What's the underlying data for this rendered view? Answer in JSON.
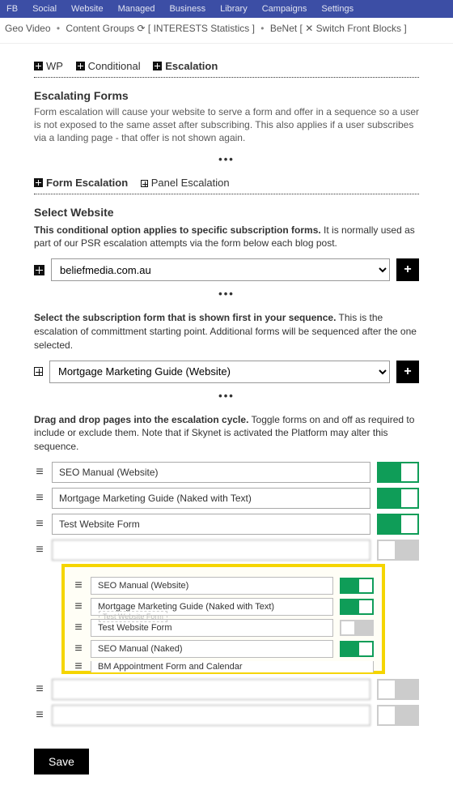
{
  "topnav": [
    "FB",
    "Social",
    "Website",
    "Managed",
    "Business",
    "Library",
    "Campaigns",
    "Settings"
  ],
  "breadcrumb": {
    "items": [
      "Geo",
      "Video",
      "Content Groups"
    ],
    "loop": "⟳",
    "bracketed1_left": "[",
    "bracketed1_a": "INTERESTS",
    "bracketed1_b": "Statistics",
    "bracketed1_right": "]",
    "benet": "BeNet",
    "bracketed2_left": "[",
    "shuffle": "✕",
    "bracketed2_a": "Switch",
    "bracketed2_b": "Front",
    "bracketed2_c": "Blocks",
    "bracketed2_right": "]"
  },
  "tabs": {
    "wp": "WP",
    "conditional": "Conditional",
    "escalation": "Escalation"
  },
  "escalating_forms": {
    "title": "Escalating Forms",
    "desc": "Form escalation will cause your website to serve a form and offer in a sequence so a user is not exposed to the same asset after subscribing. This also applies if a user subscribes via a landing page - that offer is not shown again."
  },
  "subtabs": {
    "form": "Form Escalation",
    "panel": "Panel Escalation"
  },
  "select_website": {
    "title": "Select Website",
    "desc_bold": "This conditional option applies to specific subscription forms.",
    "desc_rest": " It is normally used as part of our PSR escalation attempts via the form below each blog post.",
    "value": "beliefmedia.com.au"
  },
  "select_form": {
    "desc_bold": "Select the subscription form that is shown first in your sequence.",
    "desc_rest": " This is the escalation of committment starting point. Additional forms will be sequenced after the one selected.",
    "value": "Mortgage Marketing Guide (Website)"
  },
  "drag": {
    "desc_bold": "Drag and drop pages into the escalation cycle.",
    "desc_rest": " Toggle forms on and off as required to include or exclude them. Note that if Skynet is activated the Platform may alter this sequence."
  },
  "items_top": [
    {
      "label": "SEO Manual (Website)",
      "on": true
    },
    {
      "label": "Mortgage Marketing Guide (Naked with Text)",
      "on": true
    },
    {
      "label": "Test Website Form",
      "on": true
    }
  ],
  "items_blur_before_popup": [
    "",
    "",
    ""
  ],
  "popup_items": [
    {
      "label": "SEO Manual (Website)",
      "on": true
    },
    {
      "label": "Mortgage Marketing Guide (Naked with Text)",
      "on": true
    },
    {
      "label": "Test Website Form",
      "on": false
    },
    {
      "label": "SEO Manual (Naked)",
      "on": true
    },
    {
      "label": "BM Appointment Form and Calendar",
      "on": false,
      "cut": true
    }
  ],
  "popup_ghost": "Test Website Form",
  "items_blur_after_popup": [
    "",
    ""
  ],
  "save": "Save"
}
